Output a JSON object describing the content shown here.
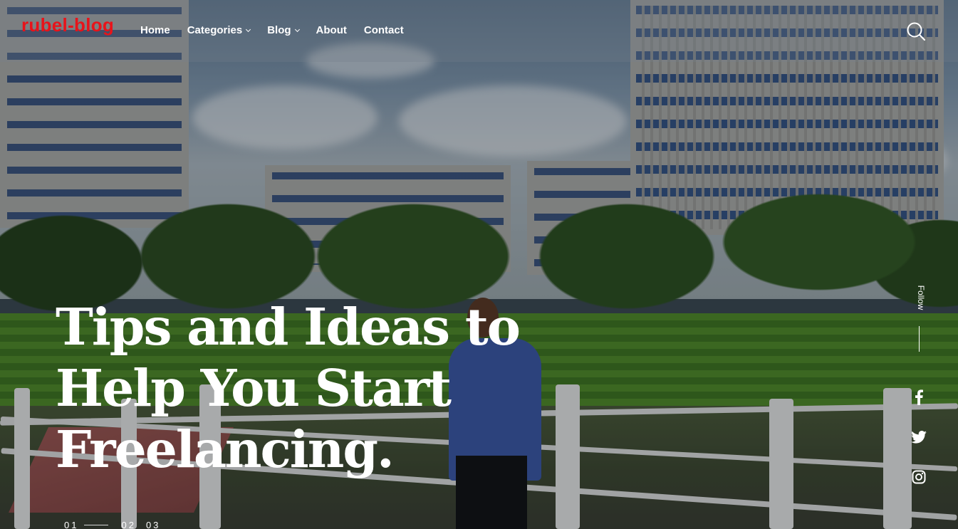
{
  "brand": {
    "logo_text": "rubel-blog",
    "logo_color": "#e8131a"
  },
  "nav": {
    "items": [
      {
        "label": "Home",
        "has_dropdown": false
      },
      {
        "label": "Categories",
        "has_dropdown": true
      },
      {
        "label": "Blog",
        "has_dropdown": true
      },
      {
        "label": "About",
        "has_dropdown": false
      },
      {
        "label": "Contact",
        "has_dropdown": false
      }
    ],
    "search_icon": "search-icon"
  },
  "hero": {
    "headline_lines": [
      "Tips and Ideas to",
      "Help You Start",
      "Freelancing."
    ]
  },
  "pager": {
    "slides": [
      "01",
      "02",
      "03"
    ],
    "active": "01"
  },
  "follow": {
    "label": "Follow",
    "links": [
      {
        "icon": "facebook-icon"
      },
      {
        "icon": "twitter-icon"
      },
      {
        "icon": "instagram-icon"
      }
    ]
  }
}
